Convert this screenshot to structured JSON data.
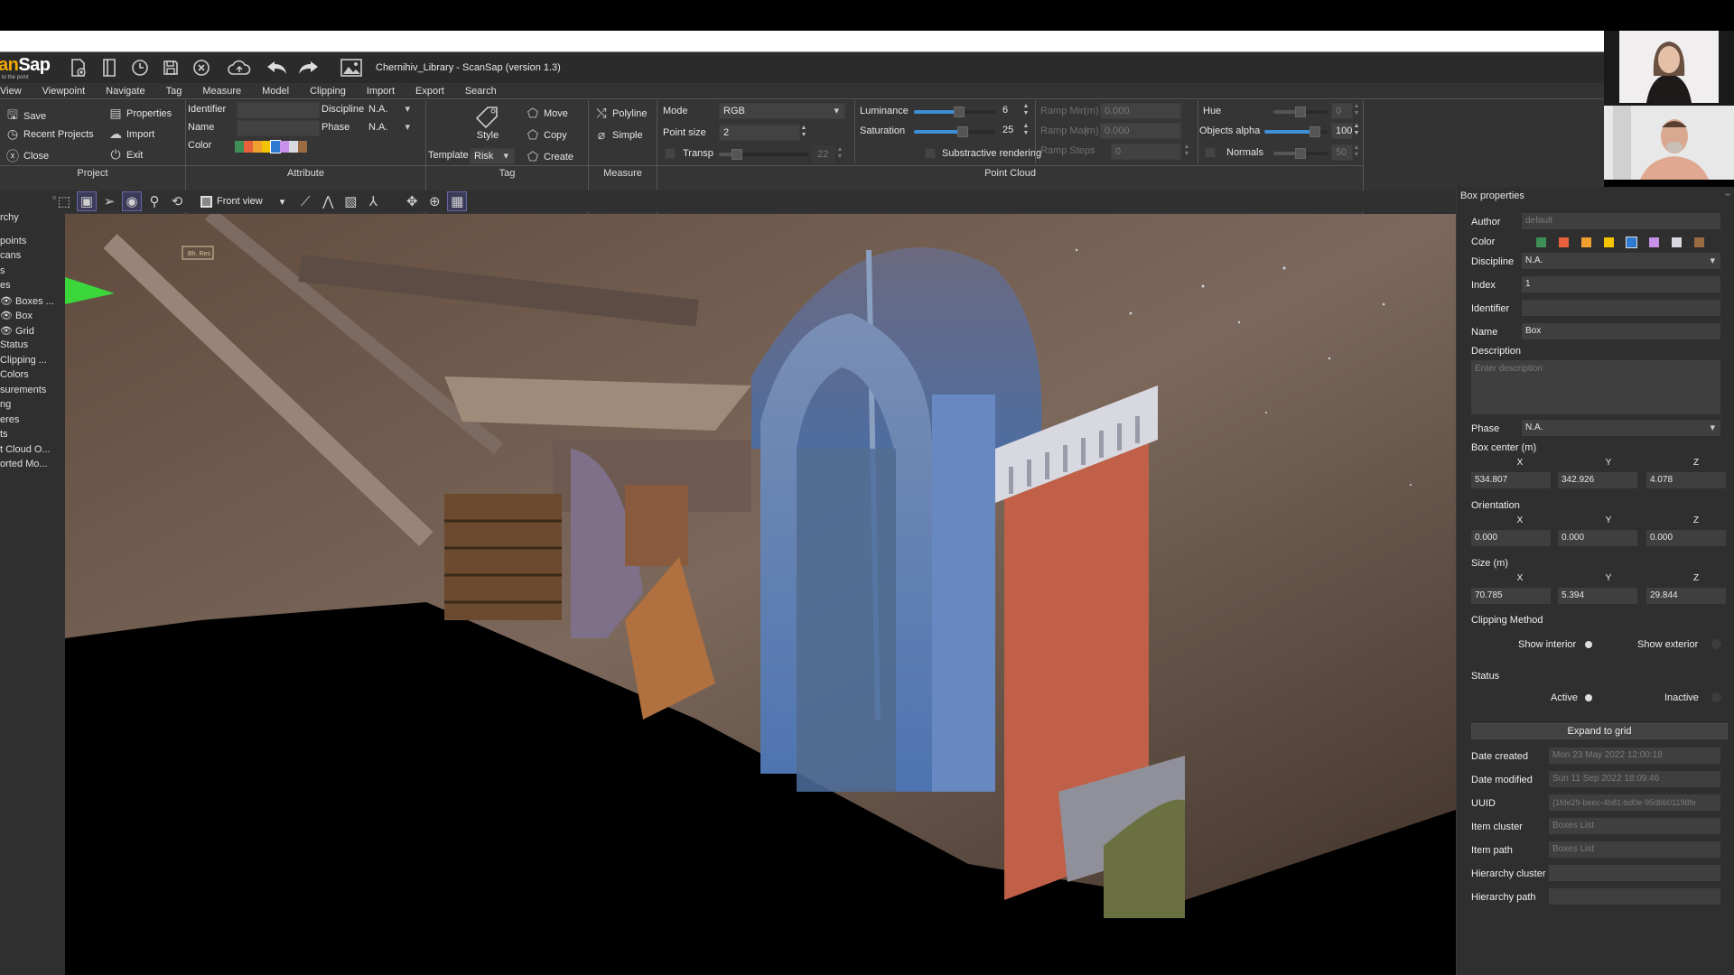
{
  "app": {
    "logo_text": "anSap",
    "logo_tagline": "to the point",
    "window_title": "Chernihiv_Library - ScanSap (version 1.3)",
    "quick_icons": [
      "new-project-icon",
      "open-project-icon",
      "history-icon",
      "save-icon",
      "close-icon",
      "cloud-upload-icon",
      "undo-icon",
      "redo-icon",
      "screenshot-icon"
    ]
  },
  "menu": [
    "View",
    "Viewpoint",
    "Navigate",
    "Tag",
    "Measure",
    "Model",
    "Clipping",
    "Import",
    "Export",
    "Search"
  ],
  "ribbon": {
    "project": {
      "label": "Project",
      "save": "Save",
      "recent": "Recent Projects",
      "close": "Close",
      "properties": "Properties",
      "import": "Import",
      "exit": "Exit"
    },
    "attribute": {
      "label": "Attribute",
      "identifier_label": "Identifier",
      "identifier_value": "",
      "name_label": "Name",
      "name_value": "",
      "color_label": "Color",
      "discipline_label": "Discipline",
      "discipline_value": "N.A.",
      "phase_label": "Phase",
      "phase_value": "N.A.",
      "colors": [
        "#3e8e58",
        "#e8603c",
        "#f0a030",
        "#f5c400",
        "#2e7ad0",
        "#c890e8",
        "#d8d8e0",
        "#9a6a40"
      ]
    },
    "tag": {
      "label": "Tag",
      "style": "Style",
      "template_label": "Template",
      "template_value": "Risk",
      "move": "Move",
      "copy": "Copy",
      "create": "Create"
    },
    "measure": {
      "label": "Measure",
      "polyline": "Polyline",
      "simple": "Simple"
    },
    "point_cloud": {
      "label": "Point Cloud",
      "mode_label": "Mode",
      "mode_value": "RGB",
      "point_size_label": "Point size",
      "point_size_value": "2",
      "transp_label": "Transp",
      "transp_value": "22",
      "transp_fraction": 0.2,
      "luminance_label": "Luminance",
      "luminance_value": "6",
      "luminance_fraction": 0.55,
      "saturation_label": "Saturation",
      "saturation_value": "25",
      "saturation_fraction": 0.6,
      "subtractive_label": "Substractive rendering",
      "ramp_min_label": "Ramp Min",
      "ramp_min_unit": "(m)",
      "ramp_min_value": "0.000",
      "ramp_max_label": "Ramp Max",
      "ramp_max_unit": "(m)",
      "ramp_max_value": "0.000",
      "ramp_steps_label": "Ramp Steps",
      "ramp_steps_value": "0",
      "hue_label": "Hue",
      "hue_value": "0",
      "hue_fraction": 0.5,
      "alpha_label": "Objects alpha",
      "alpha_value": "100",
      "alpha_fraction": 0.8,
      "normals_label": "Normals",
      "normals_value": "50",
      "normals_fraction": 0.5
    }
  },
  "toolbar": {
    "view_value": "Front view",
    "icons": [
      "select-area-icon",
      "box-clip-icon",
      "navigate-icon",
      "orbit-icon",
      "zoom-icon",
      "rotate-icon",
      "measure-line-icon",
      "angle-icon",
      "section-icon",
      "axes-icon",
      "pan-icon",
      "globe-icon",
      "texture-icon"
    ]
  },
  "hierarchy": {
    "items": [
      "rchy",
      "points",
      "cans",
      "s",
      "es",
      "Boxes ...",
      "Box",
      "Grid",
      "Status",
      "Clipping ...",
      "Colors",
      "surements",
      "ng",
      "eres",
      "ts",
      "t Cloud O...",
      "orted Mo..."
    ]
  },
  "viewport": {
    "tag_label": "Bh. Res"
  },
  "box_properties": {
    "title": "Box properties",
    "author_label": "Author",
    "author_value": "default",
    "color_label": "Color",
    "colors": [
      "#3e8e58",
      "#e8603c",
      "#f0a030",
      "#f5c400",
      "#2e7ad0",
      "#c890e8",
      "#d8d8e0",
      "#9a6a40"
    ],
    "discipline_label": "Discipline",
    "discipline_value": "N.A.",
    "index_label": "Index",
    "index_value": "1",
    "identifier_label": "Identifier",
    "identifier_value": "",
    "name_label": "Name",
    "name_value": "Box",
    "description_label": "Description",
    "description_placeholder": "Enter description",
    "phase_label": "Phase",
    "phase_value": "N.A.",
    "center_label": "Box center  (m)",
    "center": {
      "x": "534.807",
      "y": "342.926",
      "z": "4.078"
    },
    "orientation_label": "Orientation",
    "orientation": {
      "x": "0.000",
      "y": "0.000",
      "z": "0.000"
    },
    "size_label": "Size  (m)",
    "size": {
      "x": "70.785",
      "y": "5.394",
      "z": "29.844"
    },
    "axis_x": "X",
    "axis_y": "Y",
    "axis_z": "Z",
    "clipping_label": "Clipping Method",
    "show_interior": "Show interior",
    "show_exterior": "Show exterior",
    "status_label": "Status",
    "active": "Active",
    "inactive": "Inactive",
    "expand_button": "Expand to grid",
    "date_created_label": "Date created",
    "date_created_value": "Mon 23 May 2022 12:00:18",
    "date_modified_label": "Date modified",
    "date_modified_value": "Sun 11 Sep 2022 18:09:46",
    "uuid_label": "UUID",
    "uuid_value": "{1fde29-beec-4b81-bd0e-95dbb01198fe",
    "item_cluster_label": "Item cluster",
    "item_cluster_value": "Boxes List",
    "item_path_label": "Item path",
    "item_path_value": "Boxes List",
    "hierarchy_cluster_label": "Hierarchy cluster",
    "hierarchy_cluster_value": "",
    "hierarchy_path_label": "Hierarchy path",
    "hierarchy_path_value": ""
  }
}
